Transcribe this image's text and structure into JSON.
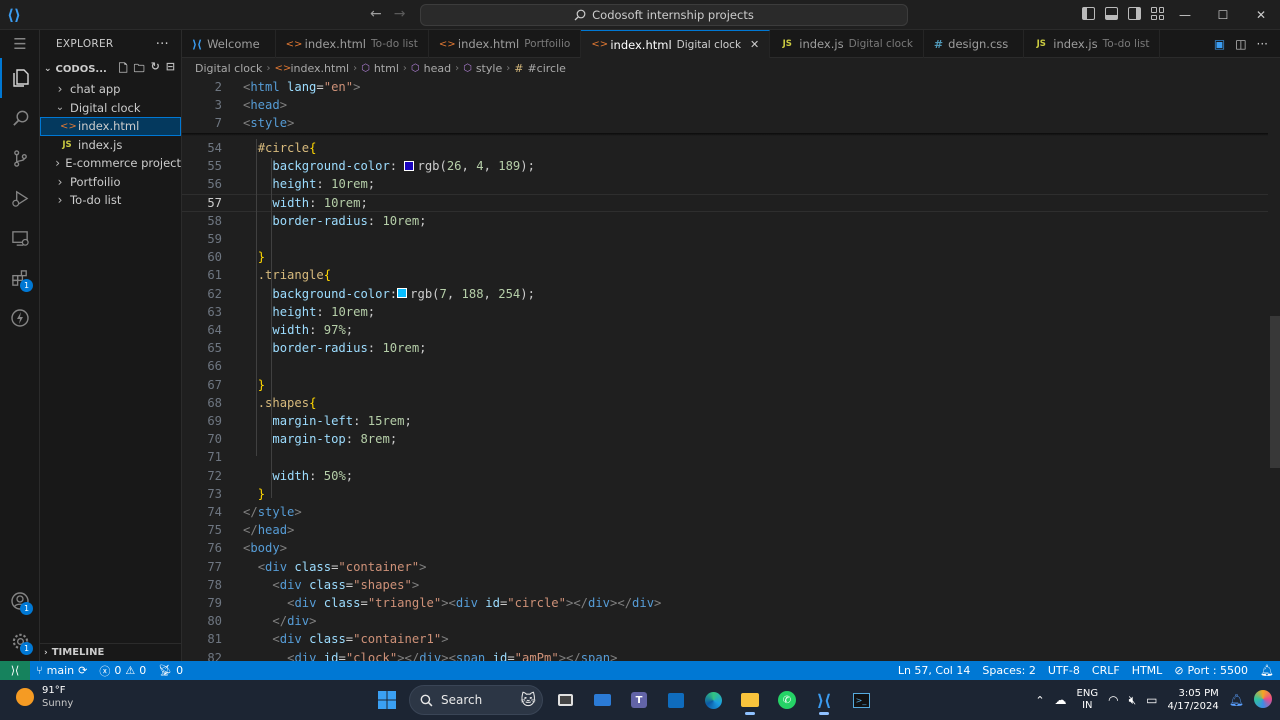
{
  "window": {
    "search": "Codosoft internship projects",
    "controls": [
      "—",
      "☐",
      "✕"
    ]
  },
  "explorer": {
    "title": "EXPLORER",
    "more": "···",
    "workspace": "CODOS...",
    "items": [
      {
        "label": "chat app",
        "type": "folder",
        "open": false,
        "depth": 0
      },
      {
        "label": "Digital clock",
        "type": "folder",
        "open": true,
        "depth": 0
      },
      {
        "label": "index.html",
        "type": "html",
        "depth": 1,
        "selected": true
      },
      {
        "label": "index.js",
        "type": "js",
        "depth": 1
      },
      {
        "label": "E-commerce project",
        "type": "folder",
        "open": false,
        "depth": 0
      },
      {
        "label": "Portfoilio",
        "type": "folder",
        "open": false,
        "depth": 0
      },
      {
        "label": "To-do list",
        "type": "folder",
        "open": false,
        "depth": 0
      }
    ],
    "timeline": "TIMELINE"
  },
  "tabs": [
    {
      "label": "Welcome",
      "desc": "",
      "icon": "vscode-icon"
    },
    {
      "label": "index.html",
      "desc": "To-do list",
      "icon": "html-icon"
    },
    {
      "label": "index.html",
      "desc": "Portfoilio",
      "icon": "html-icon"
    },
    {
      "label": "index.html",
      "desc": "Digital clock",
      "icon": "html-icon",
      "active": true
    },
    {
      "label": "index.js",
      "desc": "Digital clock",
      "icon": "js-icon"
    },
    {
      "label": "design.css",
      "desc": "",
      "icon": "css-icon"
    },
    {
      "label": "index.js",
      "desc": "To-do list",
      "icon": "js-icon"
    }
  ],
  "breadcrumb": [
    "Digital clock",
    "index.html",
    "html",
    "head",
    "style",
    "#circle"
  ],
  "editor": {
    "current_line": 57,
    "sticky": [
      {
        "n": 2,
        "tokens": [
          [
            "br",
            "<"
          ],
          [
            "tag",
            "html"
          ],
          [
            "txt",
            " "
          ],
          [
            "attr",
            "lang"
          ],
          [
            "txt",
            "="
          ],
          [
            "str",
            "\"en\""
          ],
          [
            "br",
            ">"
          ]
        ]
      },
      {
        "n": 3,
        "tokens": [
          [
            "br",
            "<"
          ],
          [
            "tag",
            "head"
          ],
          [
            "br",
            ">"
          ]
        ]
      },
      {
        "n": 7,
        "tokens": [
          [
            "br",
            "<"
          ],
          [
            "tag",
            "style"
          ],
          [
            "br",
            ">"
          ]
        ]
      }
    ],
    "lines": [
      {
        "n": 54,
        "indent": 1,
        "tokens": [
          [
            "sel",
            "#circle"
          ],
          [
            "brace",
            "{"
          ]
        ]
      },
      {
        "n": 55,
        "indent": 2,
        "tokens": [
          [
            "prop",
            "background-color"
          ],
          [
            "txt",
            ": "
          ],
          [
            "swatch",
            "#1a04bd"
          ],
          [
            "txt",
            "rgb("
          ],
          [
            "num",
            "26"
          ],
          [
            "txt",
            ", "
          ],
          [
            "num",
            "4"
          ],
          [
            "txt",
            ", "
          ],
          [
            "num",
            "189"
          ],
          [
            "txt",
            ");"
          ]
        ]
      },
      {
        "n": 56,
        "indent": 2,
        "tokens": [
          [
            "prop",
            "height"
          ],
          [
            "txt",
            ": "
          ],
          [
            "num",
            "10rem"
          ],
          [
            "txt",
            ";"
          ]
        ]
      },
      {
        "n": 57,
        "indent": 2,
        "tokens": [
          [
            "prop",
            "width"
          ],
          [
            "txt",
            ": "
          ],
          [
            "num",
            "10rem"
          ],
          [
            "txt",
            ";"
          ]
        ]
      },
      {
        "n": 58,
        "indent": 2,
        "tokens": [
          [
            "prop",
            "border-radius"
          ],
          [
            "txt",
            ": "
          ],
          [
            "num",
            "10rem"
          ],
          [
            "txt",
            ";"
          ]
        ]
      },
      {
        "n": 59,
        "indent": 2,
        "tokens": []
      },
      {
        "n": 60,
        "indent": 1,
        "tokens": [
          [
            "brace",
            "}"
          ]
        ]
      },
      {
        "n": 61,
        "indent": 1,
        "tokens": [
          [
            "sel",
            ".triangle"
          ],
          [
            "brace",
            "{"
          ]
        ]
      },
      {
        "n": 62,
        "indent": 2,
        "tokens": [
          [
            "prop",
            "background-color"
          ],
          [
            "txt",
            ":"
          ],
          [
            "swatch",
            "#07bcfe"
          ],
          [
            "txt",
            "rgb("
          ],
          [
            "num",
            "7"
          ],
          [
            "txt",
            ", "
          ],
          [
            "num",
            "188"
          ],
          [
            "txt",
            ", "
          ],
          [
            "num",
            "254"
          ],
          [
            "txt",
            ");"
          ]
        ]
      },
      {
        "n": 63,
        "indent": 2,
        "tokens": [
          [
            "prop",
            "height"
          ],
          [
            "txt",
            ": "
          ],
          [
            "num",
            "10rem"
          ],
          [
            "txt",
            ";"
          ]
        ]
      },
      {
        "n": 64,
        "indent": 2,
        "tokens": [
          [
            "prop",
            "width"
          ],
          [
            "txt",
            ": "
          ],
          [
            "num",
            "97%"
          ],
          [
            "txt",
            ";"
          ]
        ]
      },
      {
        "n": 65,
        "indent": 2,
        "tokens": [
          [
            "prop",
            "border-radius"
          ],
          [
            "txt",
            ": "
          ],
          [
            "num",
            "10rem"
          ],
          [
            "txt",
            ";"
          ]
        ]
      },
      {
        "n": 66,
        "indent": 2,
        "tokens": []
      },
      {
        "n": 67,
        "indent": 1,
        "tokens": [
          [
            "brace",
            "}"
          ]
        ]
      },
      {
        "n": 68,
        "indent": 1,
        "tokens": [
          [
            "sel",
            ".shapes"
          ],
          [
            "brace",
            "{"
          ]
        ]
      },
      {
        "n": 69,
        "indent": 2,
        "tokens": [
          [
            "prop",
            "margin-left"
          ],
          [
            "txt",
            ": "
          ],
          [
            "num",
            "15rem"
          ],
          [
            "txt",
            ";"
          ]
        ]
      },
      {
        "n": 70,
        "indent": 2,
        "tokens": [
          [
            "prop",
            "margin-top"
          ],
          [
            "txt",
            ": "
          ],
          [
            "num",
            "8rem"
          ],
          [
            "txt",
            ";"
          ]
        ]
      },
      {
        "n": 71,
        "indent": 2,
        "tokens": []
      },
      {
        "n": 72,
        "indent": 2,
        "tokens": [
          [
            "prop",
            "width"
          ],
          [
            "txt",
            ": "
          ],
          [
            "num",
            "50%"
          ],
          [
            "txt",
            ";"
          ]
        ]
      },
      {
        "n": 73,
        "indent": 1,
        "tokens": [
          [
            "brace",
            "}"
          ]
        ]
      },
      {
        "n": 74,
        "indent": 0,
        "tokens": [
          [
            "br",
            "</"
          ],
          [
            "tag",
            "style"
          ],
          [
            "br",
            ">"
          ]
        ]
      },
      {
        "n": 75,
        "indent": 0,
        "tokens": [
          [
            "br",
            "</"
          ],
          [
            "tag",
            "head"
          ],
          [
            "br",
            ">"
          ]
        ]
      },
      {
        "n": 76,
        "indent": 0,
        "tokens": [
          [
            "br",
            "<"
          ],
          [
            "tag",
            "body"
          ],
          [
            "br",
            ">"
          ]
        ]
      },
      {
        "n": 77,
        "indent": 1,
        "tokens": [
          [
            "br",
            "<"
          ],
          [
            "tag",
            "div"
          ],
          [
            "txt",
            " "
          ],
          [
            "attr",
            "class"
          ],
          [
            "txt",
            "="
          ],
          [
            "str",
            "\"container\""
          ],
          [
            "br",
            ">"
          ]
        ]
      },
      {
        "n": 78,
        "indent": 2,
        "tokens": [
          [
            "br",
            "<"
          ],
          [
            "tag",
            "div"
          ],
          [
            "txt",
            " "
          ],
          [
            "attr",
            "class"
          ],
          [
            "txt",
            "="
          ],
          [
            "str",
            "\"shapes\""
          ],
          [
            "br",
            ">"
          ]
        ]
      },
      {
        "n": 79,
        "indent": 3,
        "tokens": [
          [
            "br",
            "<"
          ],
          [
            "tag",
            "div"
          ],
          [
            "txt",
            " "
          ],
          [
            "attr",
            "class"
          ],
          [
            "txt",
            "="
          ],
          [
            "str",
            "\"triangle\""
          ],
          [
            "br",
            "><"
          ],
          [
            "tag",
            "div"
          ],
          [
            "txt",
            " "
          ],
          [
            "attr",
            "id"
          ],
          [
            "txt",
            "="
          ],
          [
            "str",
            "\"circle\""
          ],
          [
            "br",
            "></"
          ],
          [
            "tag",
            "div"
          ],
          [
            "br",
            "></"
          ],
          [
            "tag",
            "div"
          ],
          [
            "br",
            ">"
          ]
        ]
      },
      {
        "n": 80,
        "indent": 2,
        "tokens": [
          [
            "br",
            "</"
          ],
          [
            "tag",
            "div"
          ],
          [
            "br",
            ">"
          ]
        ]
      },
      {
        "n": 81,
        "indent": 2,
        "tokens": [
          [
            "br",
            "<"
          ],
          [
            "tag",
            "div"
          ],
          [
            "txt",
            " "
          ],
          [
            "attr",
            "class"
          ],
          [
            "txt",
            "="
          ],
          [
            "str",
            "\"container1\""
          ],
          [
            "br",
            ">"
          ]
        ]
      },
      {
        "n": 82,
        "indent": 3,
        "tokens": [
          [
            "br",
            "<"
          ],
          [
            "tag",
            "div"
          ],
          [
            "txt",
            " "
          ],
          [
            "attr",
            "id"
          ],
          [
            "txt",
            "="
          ],
          [
            "str",
            "\"clock\""
          ],
          [
            "br",
            "></"
          ],
          [
            "tag",
            "div"
          ],
          [
            "br",
            "><"
          ],
          [
            "tag",
            "span"
          ],
          [
            "txt",
            " "
          ],
          [
            "attr",
            "id"
          ],
          [
            "txt",
            "="
          ],
          [
            "str",
            "\"amPm\""
          ],
          [
            "br",
            "></"
          ],
          [
            "tag",
            "span"
          ],
          [
            "br",
            ">"
          ]
        ]
      }
    ]
  },
  "statusbar": {
    "branch": "main",
    "errors": "0",
    "warnings": "0",
    "ports": "0",
    "position": "Ln 57, Col 14",
    "spaces": "Spaces: 2",
    "encoding": "UTF-8",
    "eol": "CRLF",
    "language": "HTML",
    "port": "Port : 5500"
  },
  "taskbar": {
    "temp": "91°F",
    "condition": "Sunny",
    "search": "Search",
    "lang1": "ENG",
    "lang2": "IN",
    "time": "3:05 PM",
    "date": "4/17/2024"
  },
  "colors": {
    "accent": "#0078d4",
    "circle_swatch": "#1a04bd",
    "triangle_swatch": "#07bcfe"
  }
}
